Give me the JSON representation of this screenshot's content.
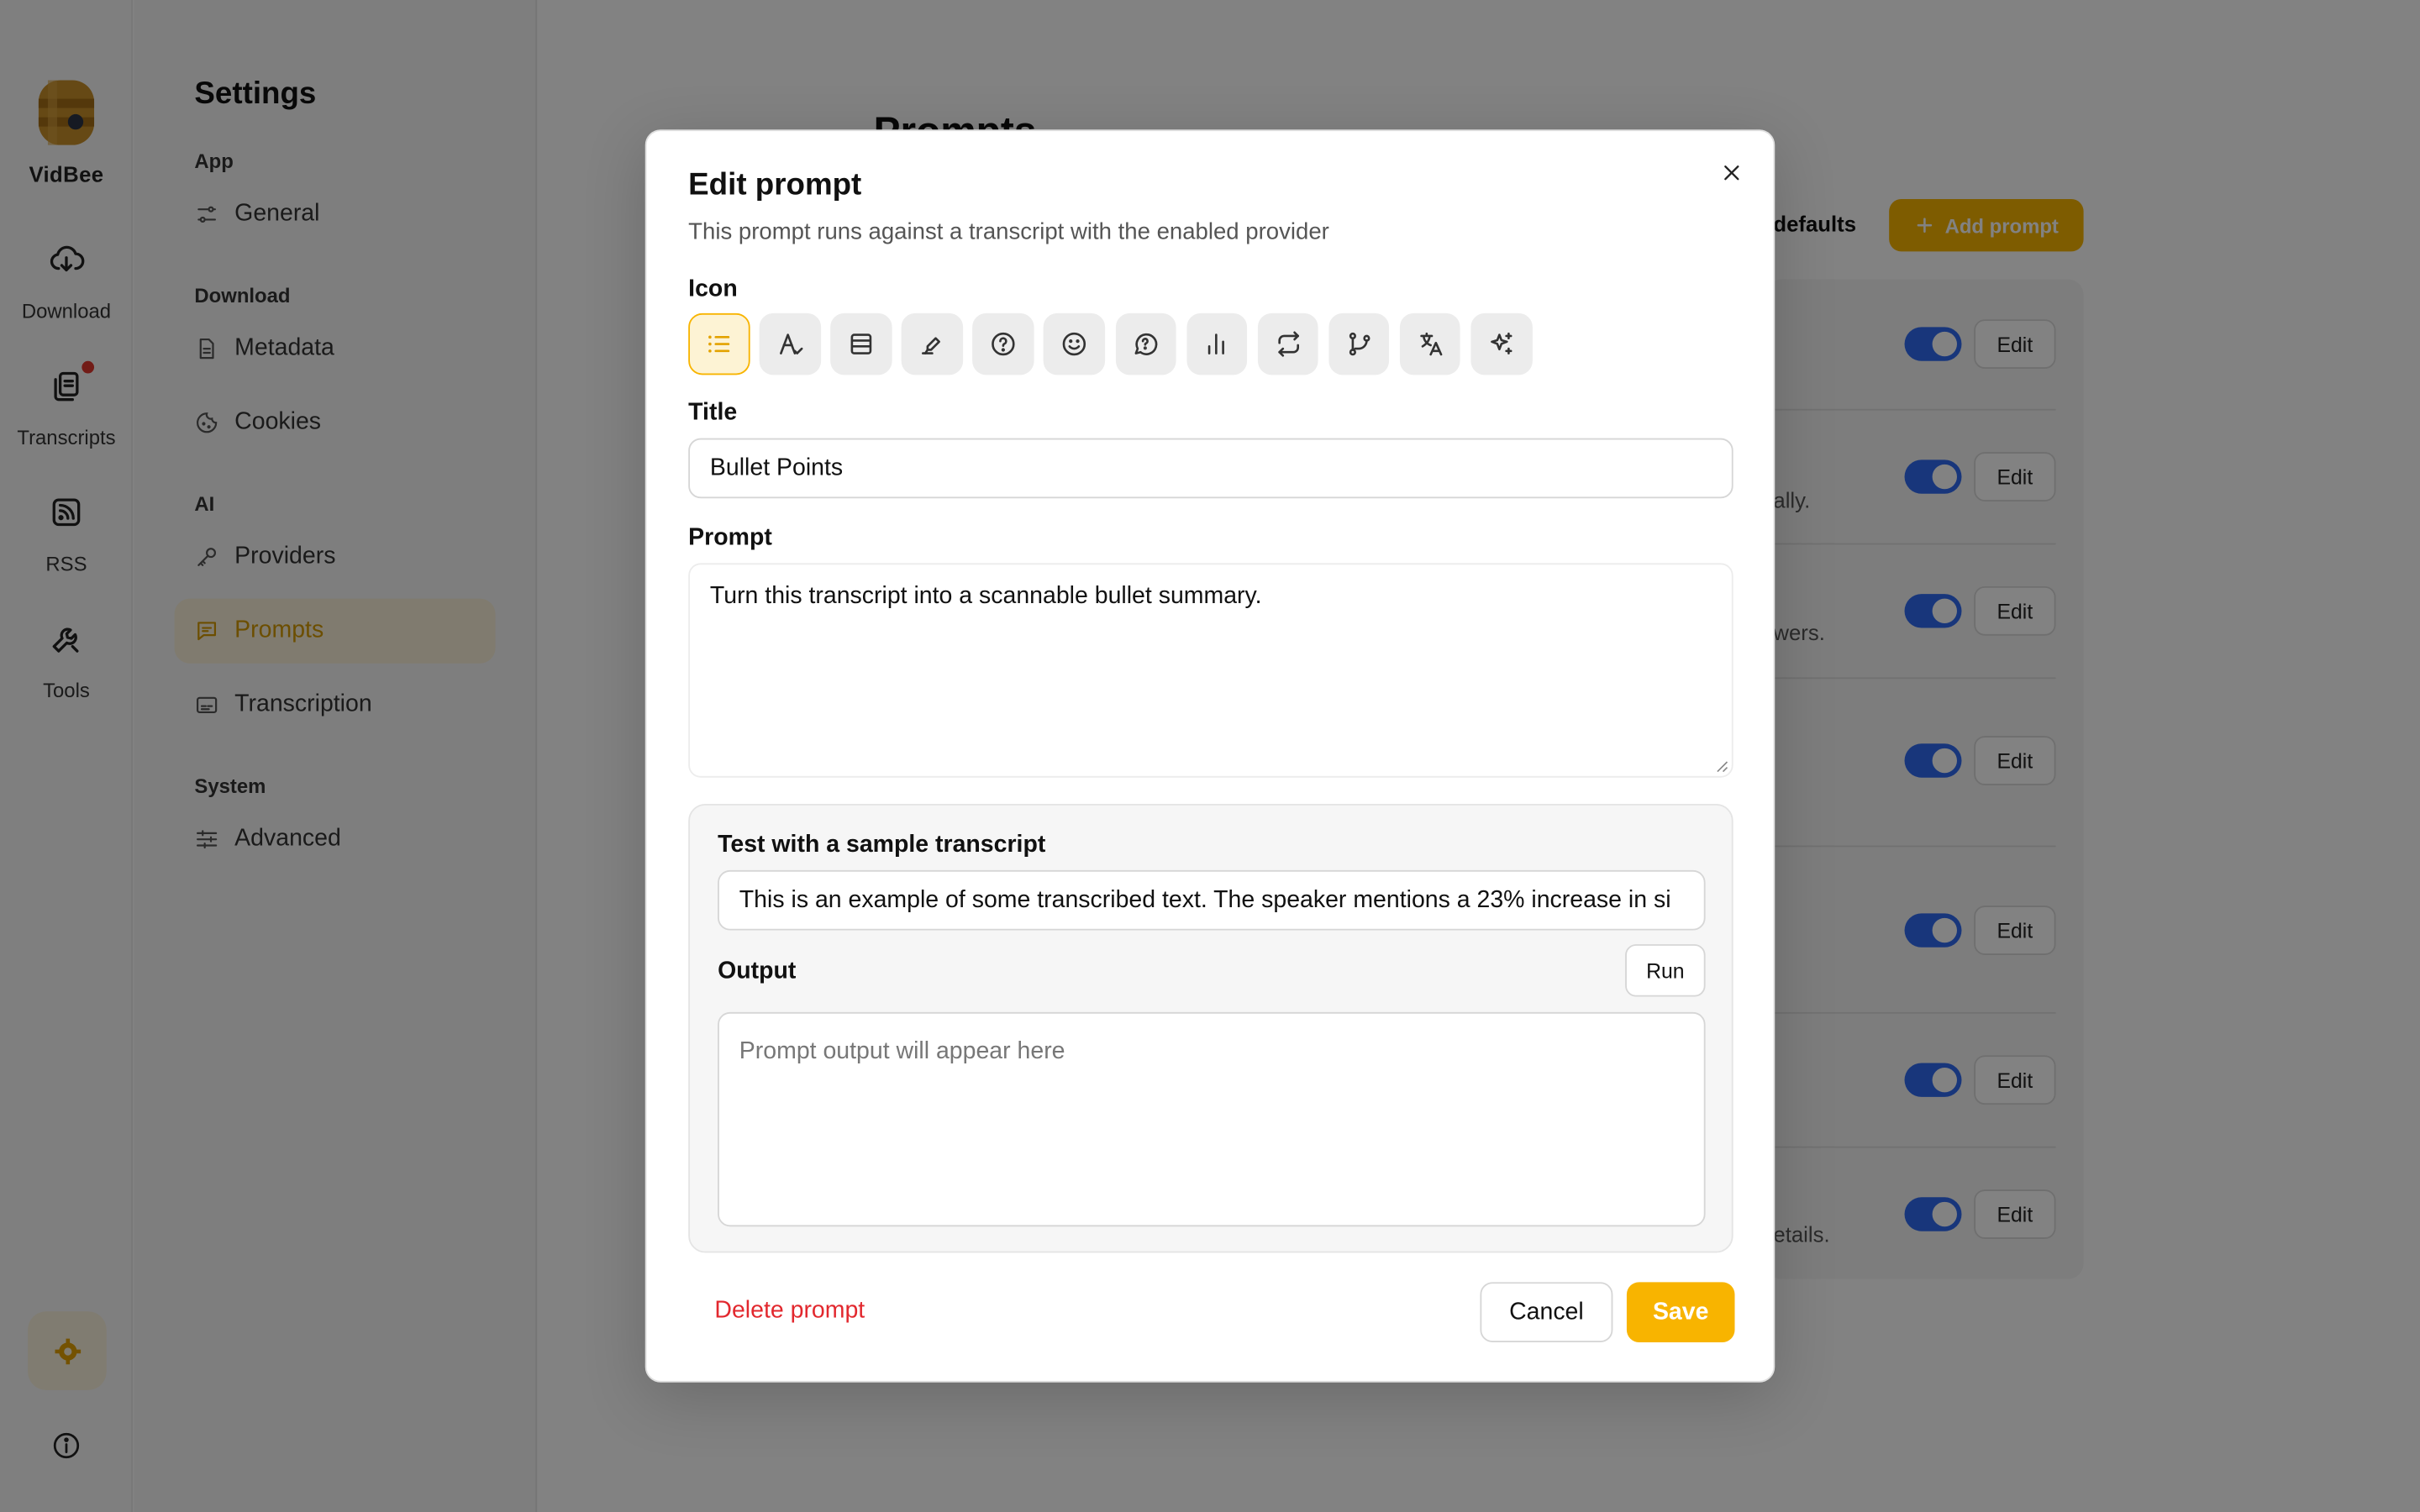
{
  "app": {
    "name": "VidBee"
  },
  "rail": {
    "items": [
      {
        "label": "Download",
        "icon": "cloud-download-icon"
      },
      {
        "label": "Transcripts",
        "icon": "copy-icon"
      },
      {
        "label": "RSS",
        "icon": "rss-icon"
      },
      {
        "label": "Tools",
        "icon": "wrench-icon"
      }
    ]
  },
  "sidebar": {
    "title": "Settings",
    "sections": {
      "app": "App",
      "download": "Download",
      "ai": "AI",
      "system": "System"
    },
    "items": {
      "general": "General",
      "metadata": "Metadata",
      "cookies": "Cookies",
      "providers": "Providers",
      "prompts": "Prompts",
      "transcription": "Transcription",
      "advanced": "Advanced"
    }
  },
  "main": {
    "title": "Prompts",
    "restore_label": "defaults",
    "add_label": "Add prompt",
    "edit_label": "Edit",
    "row_snippets": [
      "ally.",
      "wers.",
      "etails."
    ]
  },
  "modal": {
    "title": "Edit prompt",
    "subtitle": "This prompt runs against a transcript with the enabled provider",
    "icon_label": "Icon",
    "title_label": "Title",
    "title_value": "Bullet Points",
    "prompt_label": "Prompt",
    "prompt_value": "Turn this transcript into a scannable bullet summary.",
    "test": {
      "label": "Test with a sample transcript",
      "sample_value": "This is an example of some transcribed text. The speaker mentions a 23% increase in si",
      "output_label": "Output",
      "run_label": "Run",
      "output_placeholder": "Prompt output will appear here"
    },
    "delete_label": "Delete prompt",
    "cancel_label": "Cancel",
    "save_label": "Save",
    "icon_options": [
      "list-icon",
      "text-icon",
      "table-icon",
      "highlighter-icon",
      "question-circle-icon",
      "smile-icon",
      "message-question-icon",
      "bar-chart-icon",
      "repeat-icon",
      "git-branch-icon",
      "languages-icon",
      "sparkles-icon"
    ]
  },
  "colors": {
    "accent": "#f8b400",
    "danger": "#e2282e",
    "toggle": "#2f6bf2"
  }
}
